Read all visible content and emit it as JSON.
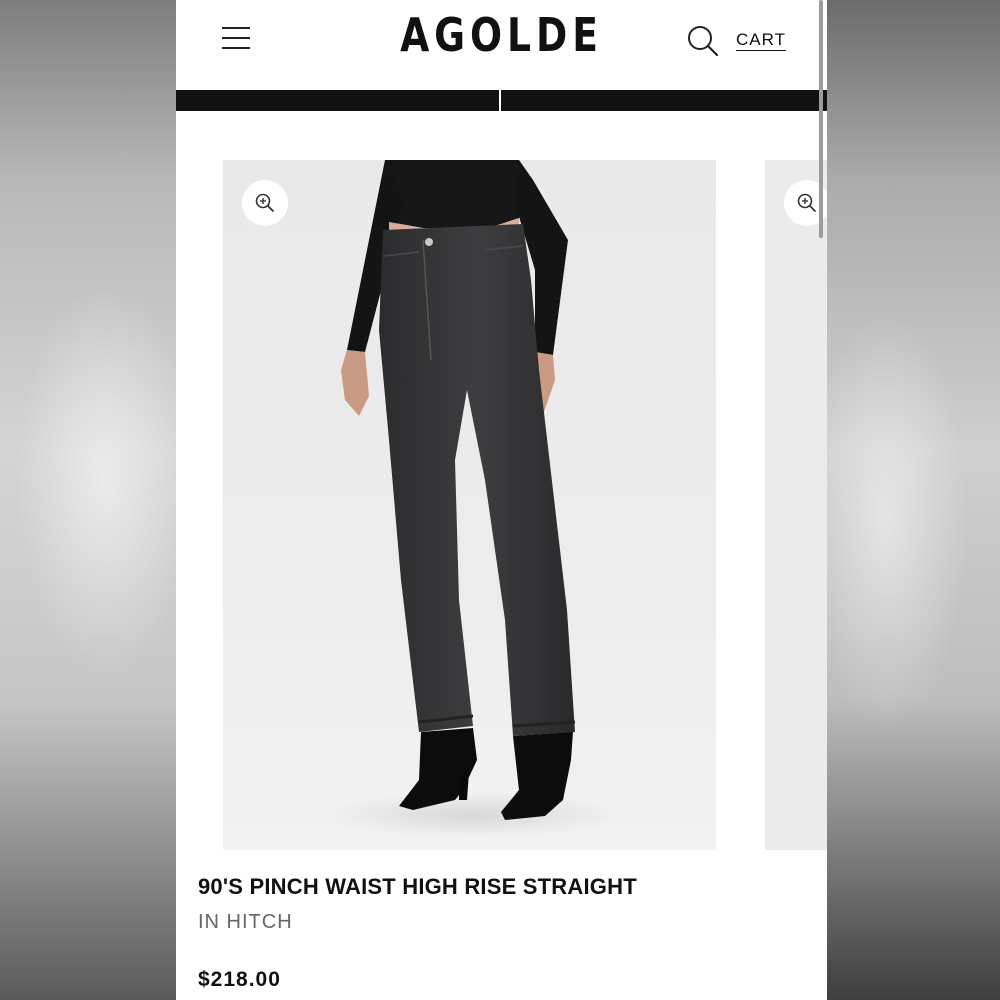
{
  "header": {
    "brand": "AGOLDE",
    "menu_icon": "hamburger-menu-icon",
    "search_icon": "search-icon",
    "cart_label": "CART"
  },
  "product": {
    "title": "90'S PINCH WAIST HIGH RISE STRAIGHT",
    "color": "IN HITCH",
    "price": "$218.00",
    "zoom_icon": "zoom-in-icon"
  },
  "colors": {
    "background": "#ffffff",
    "text": "#111111",
    "muted": "#666666",
    "bar": "#111111"
  }
}
